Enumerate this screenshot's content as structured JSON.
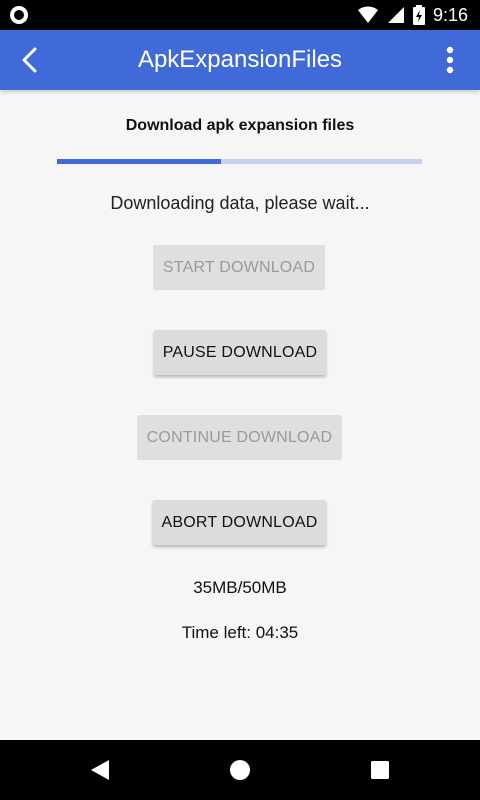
{
  "status_bar": {
    "time": "9:16",
    "icons": [
      "record-icon",
      "wifi-icon",
      "cellular-icon",
      "battery-icon"
    ]
  },
  "app_bar": {
    "title": "ApkExpansionFiles",
    "color": "#3f6ad8",
    "icons": [
      "back-icon",
      "more-vert-icon"
    ]
  },
  "main": {
    "heading": "Download apk expansion files",
    "progress": 0.45,
    "status_text": "Downloading data, please wait...",
    "buttons": {
      "start": "START DOWNLOAD",
      "pause": "PAUSE DOWNLOAD",
      "continue": "CONTINUE DOWNLOAD",
      "abort": "ABORT DOWNLOAD"
    },
    "button_state": {
      "start": "disabled",
      "pause": "enabled",
      "continue": "disabled",
      "abort": "enabled"
    },
    "size_text": "35MB/50MB",
    "time_left": "Time left: 04:35"
  },
  "nav_bar": {
    "icons": [
      "nav-back-icon",
      "home-icon",
      "recents-icon"
    ]
  }
}
